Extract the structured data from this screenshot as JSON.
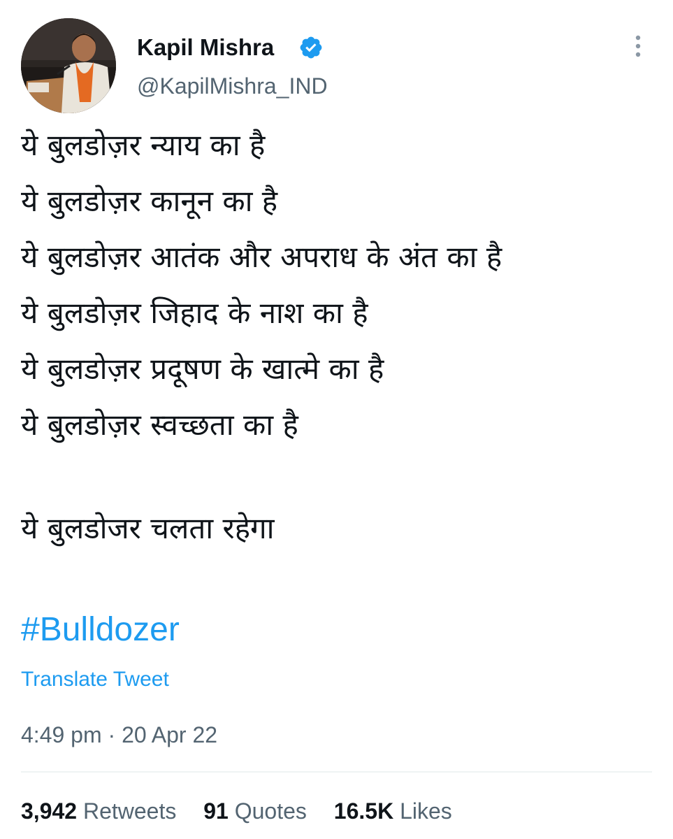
{
  "author": {
    "name": "Kapil Mishra",
    "handle": "@KapilMishra_IND",
    "verified": true
  },
  "tweet": {
    "lines": [
      "ये बुलडोज़र न्याय का है",
      "ये बुलडोज़र कानून का है",
      "ये बुलडोज़र आतंक और अपराध के अंत का है",
      "ये बुलडोज़र जिहाद के नाश का है",
      "ये बुलडोज़र प्रदूषण के खात्मे का है",
      "ये बुलडोज़र स्वच्छता का है",
      "ये बुलडोजर चलता रहेगा"
    ],
    "hashtag": "#Bulldozer",
    "translate_label": "Translate Tweet",
    "time": "4:49 pm",
    "separator": "·",
    "date": "20 Apr 22"
  },
  "stats": {
    "retweets_count": "3,942",
    "retweets_label": "Retweets",
    "quotes_count": "91",
    "quotes_label": "Quotes",
    "likes_count": "16.5K",
    "likes_label": "Likes"
  },
  "colors": {
    "link": "#1d9bf0",
    "secondary_text": "#536471",
    "primary_text": "#0f1419",
    "divider": "#eff3f4"
  },
  "icons": {
    "verified": "verified-badge-icon",
    "more": "more-vertical-icon"
  }
}
